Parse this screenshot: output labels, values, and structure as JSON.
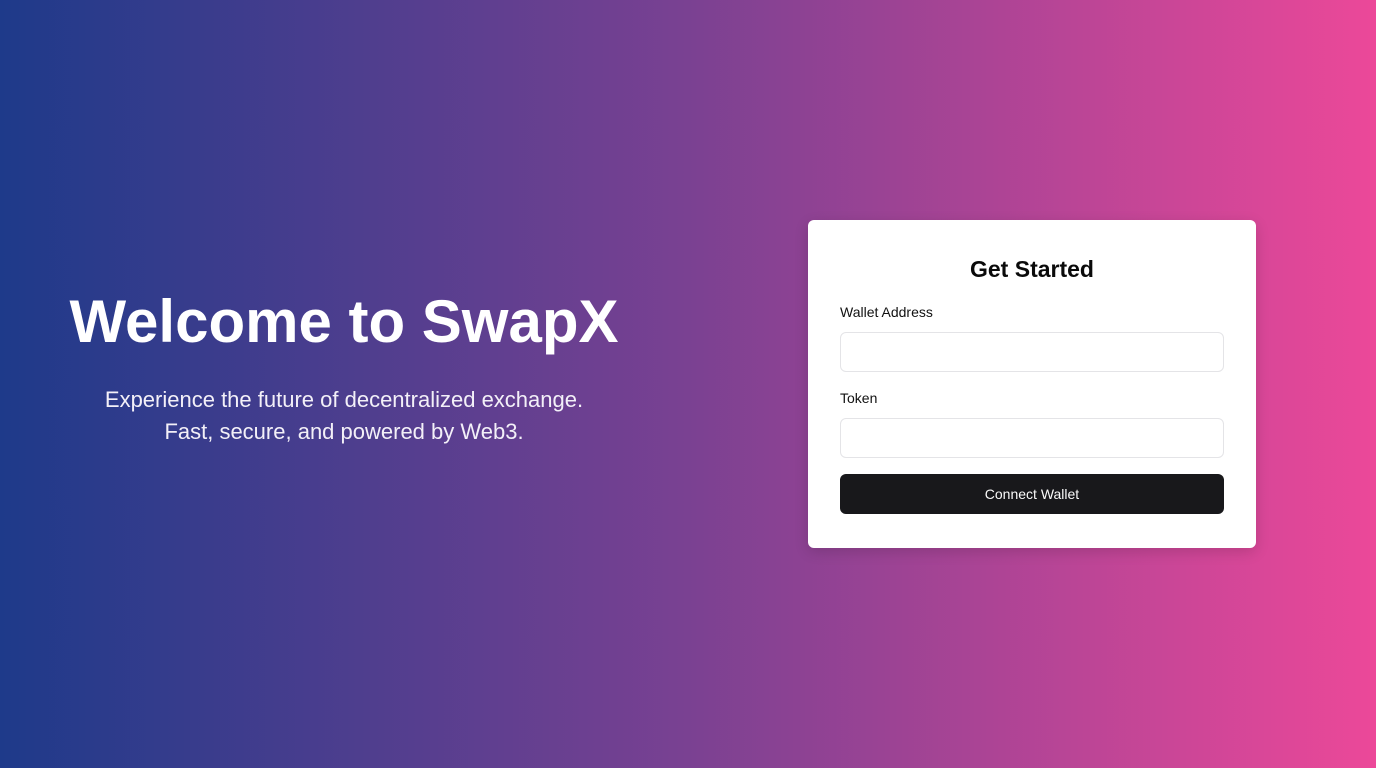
{
  "hero": {
    "title": "Welcome to SwapX",
    "subtitle": "Experience the future of decentralized exchange. Fast, secure, and powered by Web3."
  },
  "form": {
    "title": "Get Started",
    "wallet_label": "Wallet Address",
    "wallet_value": "",
    "token_label": "Token",
    "token_value": "",
    "submit_label": "Connect Wallet"
  },
  "colors": {
    "gradient_start": "#1e3a8a",
    "gradient_end": "#ec4899",
    "button": "#18181b"
  }
}
